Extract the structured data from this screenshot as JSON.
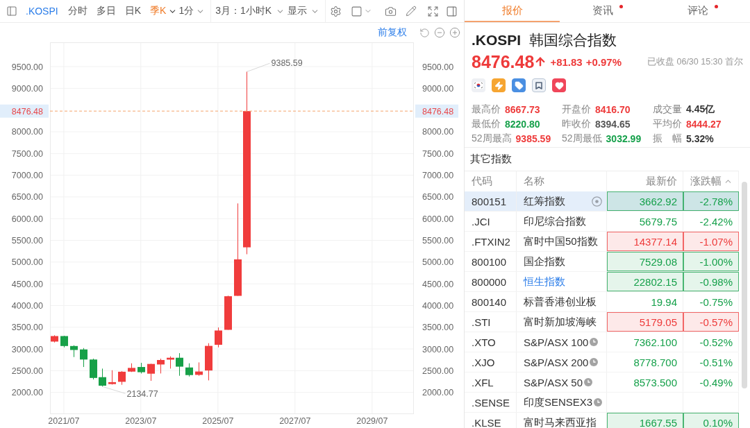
{
  "toolbar": {
    "symbol": ".KOSPI",
    "periods": [
      {
        "label": "分时",
        "selected": false,
        "dropdown": false
      },
      {
        "label": "多日",
        "selected": false,
        "dropdown": false
      },
      {
        "label": "日K",
        "selected": false,
        "dropdown": false
      },
      {
        "label": "季K",
        "selected": true,
        "dropdown": true
      },
      {
        "label": "1分",
        "selected": false,
        "dropdown": true
      }
    ],
    "range": "3月：1小时K",
    "display": "显示"
  },
  "chart_toolbar": {
    "adjust": "前复权"
  },
  "chart_data": [
    {
      "type": "candlestick",
      "x": [
        "2021-04-01",
        "2021-07-01",
        "2021-10-01",
        "2022-01-01",
        "2022-04-01",
        "2022-07-01",
        "2022-10-01",
        "2023-01-01",
        "2023-04-01",
        "2023-07-01",
        "2023-10-01",
        "2024-01-01",
        "2024-04-01",
        "2024-07-01",
        "2024-10-01",
        "2025-01-01",
        "2025-04-01",
        "2025-07-01",
        "2025-10-01",
        "2026-01-01",
        "2026-04-01"
      ],
      "ohlc": [
        [
          3170,
          3316,
          3150,
          3297
        ],
        [
          3297,
          3305,
          3037,
          3068
        ],
        [
          3068,
          3085,
          2814,
          2977
        ],
        [
          2989,
          3021,
          2585,
          2757
        ],
        [
          2757,
          2777,
          2298,
          2333
        ],
        [
          2351,
          2548,
          2134.77,
          2155
        ],
        [
          2192,
          2510,
          2180,
          2236
        ],
        [
          2244,
          2490,
          2175,
          2476
        ],
        [
          2479,
          2670,
          2470,
          2564
        ],
        [
          2585,
          2681,
          2436,
          2465
        ],
        [
          2431,
          2660,
          2266,
          2655
        ],
        [
          2643,
          2777,
          2436,
          2746
        ],
        [
          2755,
          2830,
          2548,
          2798
        ],
        [
          2798,
          2904,
          2383,
          2593
        ],
        [
          2574,
          2670,
          2367,
          2399
        ],
        [
          2404,
          2691,
          2383,
          2481
        ],
        [
          2505,
          3133,
          2277,
          3071
        ],
        [
          3096,
          3495,
          3037,
          3425
        ],
        [
          3441,
          4226,
          3441,
          4214
        ],
        [
          4223,
          6351,
          4223,
          5063
        ],
        [
          5340,
          9385.59,
          5181,
          8476.48
        ]
      ],
      "xlim": [
        "2021-02-20",
        "2030-08-01"
      ],
      "ylim": [
        1500,
        10060
      ],
      "y2lim": [
        1500,
        10060
      ],
      "xticks": [
        {
          "value": "2021-07-01",
          "label": "2021/07"
        },
        {
          "value": "2023-07-01",
          "label": "2023/07"
        },
        {
          "value": "2025-07-01",
          "label": "2025/07"
        },
        {
          "value": "2027-07-01",
          "label": "2027/07"
        },
        {
          "value": "2029-07-01",
          "label": "2029/07"
        }
      ],
      "yticks": [
        {
          "value": 2000,
          "label": "2000.00"
        },
        {
          "value": 2500,
          "label": "2500.00"
        },
        {
          "value": 3000,
          "label": "3000.00"
        },
        {
          "value": 3500,
          "label": "3500.00"
        },
        {
          "value": 4000,
          "label": "4000.00"
        },
        {
          "value": 4500,
          "label": "4500.00"
        },
        {
          "value": 5000,
          "label": "5000.00"
        },
        {
          "value": 5500,
          "label": "5500.00"
        },
        {
          "value": 6000,
          "label": "6000.00"
        },
        {
          "value": 6500,
          "label": "6500.00"
        },
        {
          "value": 7000,
          "label": "7000.00"
        },
        {
          "value": 7500,
          "label": "7500.00"
        },
        {
          "value": 8000,
          "label": "8000.00"
        },
        {
          "value": 9000,
          "label": "9000.00"
        },
        {
          "value": 9500,
          "label": "9500.00"
        }
      ],
      "y2ticks": [
        {
          "value": 2000,
          "label": "2000.00"
        },
        {
          "value": 2500,
          "label": "2500.00"
        },
        {
          "value": 3000,
          "label": "3000.00"
        },
        {
          "value": 3500,
          "label": "3500.00"
        },
        {
          "value": 4000,
          "label": "4000.00"
        },
        {
          "value": 4500,
          "label": "4500.00"
        },
        {
          "value": 5000,
          "label": "5000.00"
        },
        {
          "value": 5500,
          "label": "5500.00"
        },
        {
          "value": 6000,
          "label": "6000.00"
        },
        {
          "value": 6500,
          "label": "6500.00"
        },
        {
          "value": 7000,
          "label": "7000.00"
        },
        {
          "value": 7500,
          "label": "7500.00"
        },
        {
          "value": 8000,
          "label": "8000.00"
        },
        {
          "value": 8476.48,
          "label": "8476.48"
        },
        {
          "value": 9000,
          "label": "9000.00"
        },
        {
          "value": 9500,
          "label": "9500.00"
        }
      ],
      "ref_lines": [
        {
          "axis": "y",
          "value": 8476.48,
          "label": "8476.48",
          "color": "#f5a36b",
          "line_style": "dashed"
        }
      ],
      "annotations": [
        "9385.59",
        "2134.77"
      ],
      "grid": true
    }
  ],
  "panel_tabs": [
    {
      "label": "报价",
      "selected": true,
      "badge": false
    },
    {
      "label": "资讯",
      "selected": false,
      "badge": true
    },
    {
      "label": "评论",
      "selected": false,
      "badge": true
    }
  ],
  "quote": {
    "symbol": ".KOSPI",
    "name": "韩国综合指数",
    "price": "8476.48",
    "rising": true,
    "change": "+81.83",
    "change_pct": "+0.97%",
    "status": "已收盘 06/30 15:30 首尔"
  },
  "stats": [
    {
      "label": "最高价",
      "value": "8667.73",
      "color": "#ee3a3a"
    },
    {
      "label": "开盘价",
      "value": "8416.70",
      "color": "#ee3a3a"
    },
    {
      "label": "成交量",
      "value": "4.45亿",
      "color": "#333333"
    },
    {
      "label": "最低价",
      "value": "8220.80",
      "color": "#15a04a"
    },
    {
      "label": "昨收价",
      "value": "8394.65",
      "color": "#555555"
    },
    {
      "label": "平均价",
      "value": "8444.27",
      "color": "#ee3a3a"
    },
    {
      "label": "52周最高",
      "value": "9385.59",
      "color": "#ee3a3a"
    },
    {
      "label": "52周最低",
      "value": "3032.99",
      "color": "#15a04a"
    },
    {
      "label": "振　幅",
      "value": "5.32%",
      "color": "#333333"
    }
  ],
  "other_indices": {
    "title": "其它指数",
    "columns": [
      {
        "label": "代码",
        "sorted": false
      },
      {
        "label": "名称",
        "sorted": false
      },
      {
        "label": "最新价",
        "sorted": false
      },
      {
        "label": "涨跌幅",
        "sorted": true
      }
    ],
    "rows": [
      {
        "code": "800151",
        "name": "红筹指数",
        "price": "3662.92",
        "change": "-2.78%",
        "color": "#15a04a",
        "highlighted": true,
        "selected": true,
        "delayed": false,
        "link": false
      },
      {
        "code": ".JCI",
        "name": "印尼综合指数",
        "price": "5679.75",
        "change": "-2.42%",
        "color": "#15a04a",
        "highlighted": false,
        "selected": false,
        "delayed": false,
        "link": false
      },
      {
        "code": ".FTXIN2",
        "name": "富时中国50指数",
        "price": "14377.14",
        "change": "-1.07%",
        "color": "#ee3a3a",
        "highlighted": true,
        "selected": false,
        "delayed": false,
        "link": false
      },
      {
        "code": "800100",
        "name": "国企指数",
        "price": "7529.08",
        "change": "-1.00%",
        "color": "#15a04a",
        "highlighted": true,
        "selected": false,
        "delayed": false,
        "link": false
      },
      {
        "code": "800000",
        "name": "恒生指数",
        "price": "22802.15",
        "change": "-0.98%",
        "color": "#15a04a",
        "highlighted": true,
        "selected": false,
        "delayed": false,
        "link": true
      },
      {
        "code": "800140",
        "name": "标普香港创业板",
        "price": "19.94",
        "change": "-0.75%",
        "color": "#15a04a",
        "highlighted": false,
        "selected": false,
        "delayed": false,
        "link": false
      },
      {
        "code": ".STI",
        "name": "富时新加坡海峡",
        "price": "5179.05",
        "change": "-0.57%",
        "color": "#ee3a3a",
        "highlighted": true,
        "selected": false,
        "delayed": false,
        "link": false
      },
      {
        "code": ".XTO",
        "name": "S&P/ASX 100",
        "price": "7362.100",
        "change": "-0.52%",
        "color": "#15a04a",
        "highlighted": false,
        "selected": false,
        "delayed": true,
        "link": false
      },
      {
        "code": ".XJO",
        "name": "S&P/ASX 200",
        "price": "8778.700",
        "change": "-0.51%",
        "color": "#15a04a",
        "highlighted": false,
        "selected": false,
        "delayed": true,
        "link": false
      },
      {
        "code": ".XFL",
        "name": "S&P/ASX 50",
        "price": "8573.500",
        "change": "-0.49%",
        "color": "#15a04a",
        "highlighted": false,
        "selected": false,
        "delayed": true,
        "link": false
      },
      {
        "code": ".SENSE",
        "name": "印度SENSEX3",
        "selected": false,
        "delayed": true,
        "link": false
      },
      {
        "code": ".KLSE",
        "name": "富时马来西亚指",
        "price": "1667.55",
        "change": "0.10%",
        "color": "#15a04a",
        "highlighted": true,
        "selected": false,
        "delayed": false,
        "link": false
      }
    ]
  }
}
